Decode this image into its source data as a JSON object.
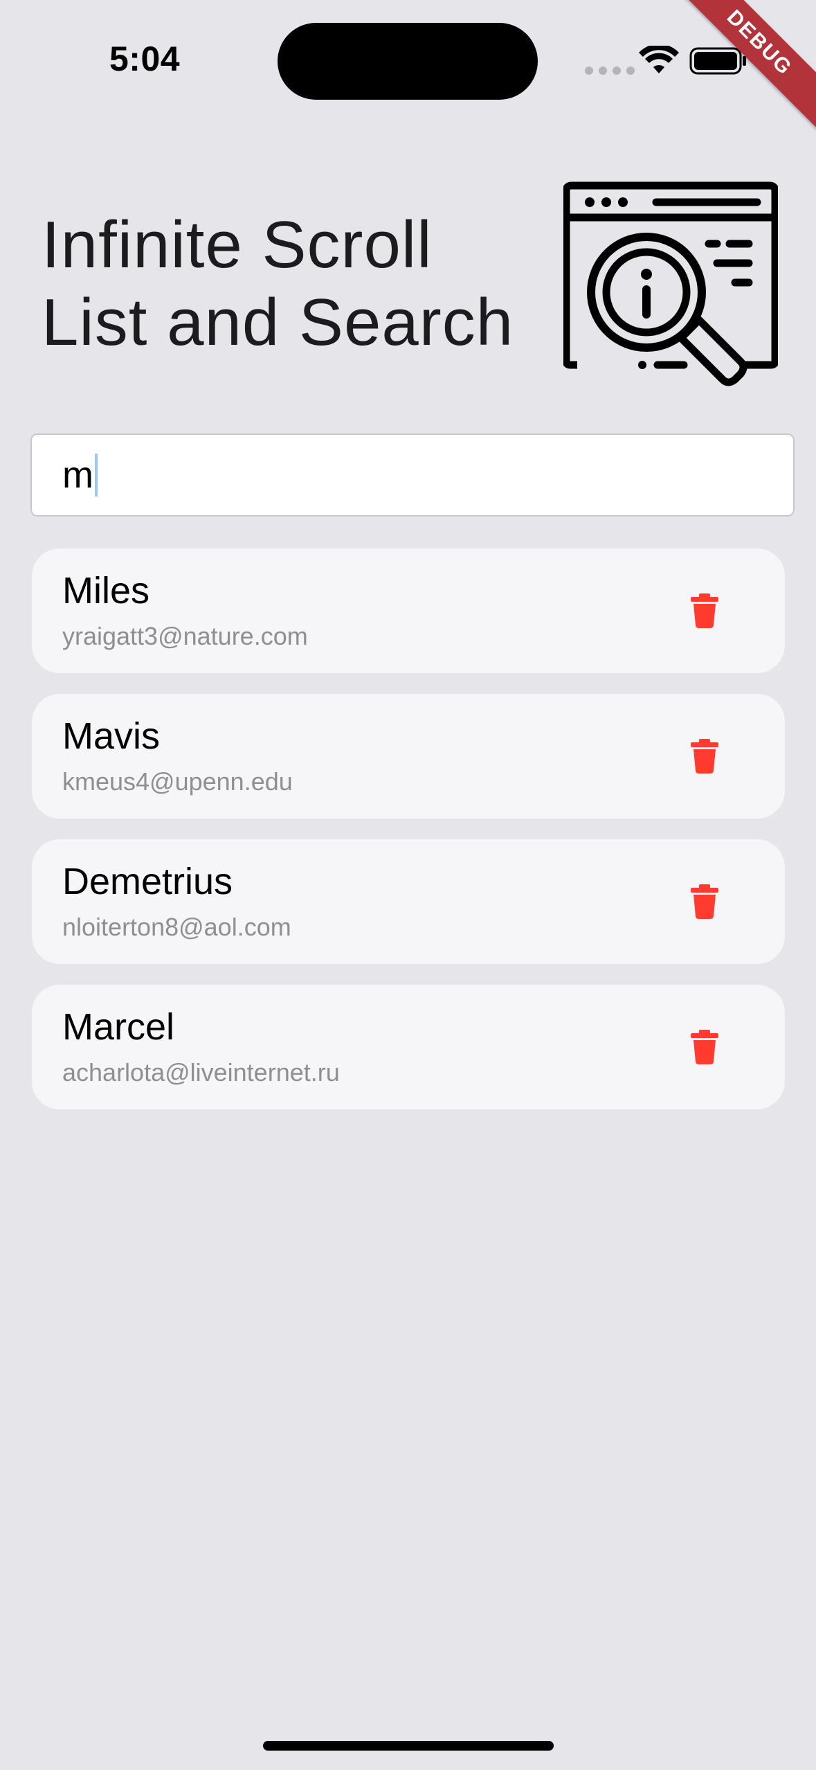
{
  "status_bar": {
    "time": "5:04",
    "debug_label": "DEBUG"
  },
  "header": {
    "title": "Infinite Scroll List and Search",
    "illustration_icon": "browser-magnifier-info-icon"
  },
  "search": {
    "value": "m",
    "placeholder": ""
  },
  "results": [
    {
      "name": "Miles",
      "email": "yraigatt3@nature.com"
    },
    {
      "name": "Mavis",
      "email": "kmeus4@upenn.edu"
    },
    {
      "name": "Demetrius",
      "email": "nloiterton8@aol.com"
    },
    {
      "name": "Marcel",
      "email": "acharlota@liveinternet.ru"
    }
  ],
  "colors": {
    "background": "#e5e5ea",
    "card": "#f6f6f8",
    "delete": "#ff3b30",
    "debug_banner": "#b3333b"
  },
  "icons": {
    "delete": "trash-icon"
  }
}
